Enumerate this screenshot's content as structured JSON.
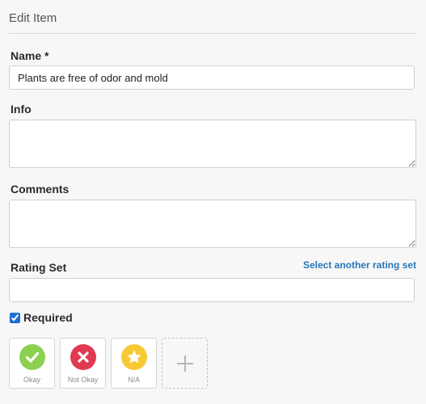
{
  "dialog": {
    "title": "Edit Item"
  },
  "form": {
    "name_label": "Name *",
    "name_value": "Plants are free of odor and mold",
    "info_label": "Info",
    "info_value": "",
    "comments_label": "Comments",
    "comments_value": "",
    "rating_set_label": "Rating Set",
    "rating_set_link": "Select another rating set",
    "rating_set_value": "",
    "required_label": "Required",
    "required_checked": true
  },
  "ratings": [
    {
      "label": "Okay",
      "icon": "check-icon",
      "color": "#8bd14f"
    },
    {
      "label": "Not Okay",
      "icon": "x-icon",
      "color": "#e03a52"
    },
    {
      "label": "N/A",
      "icon": "star-icon",
      "color": "#f7c934"
    }
  ],
  "add_rating": {
    "icon": "plus-icon"
  }
}
